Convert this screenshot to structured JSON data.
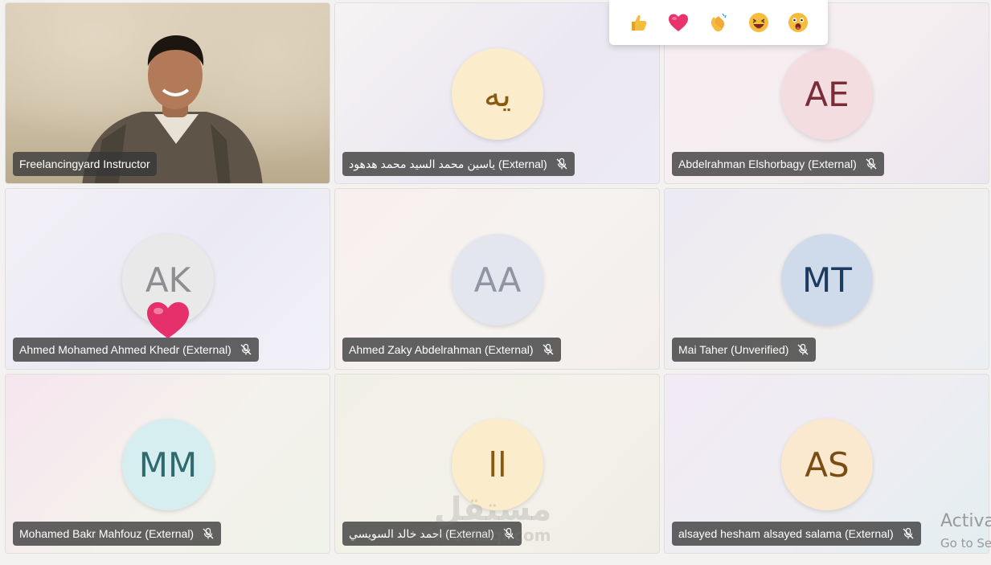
{
  "reactions": [
    {
      "name": "like",
      "icon": "thumbs-up-icon",
      "color": "#f2b233"
    },
    {
      "name": "heart",
      "icon": "heart-icon",
      "color": "#e8336d"
    },
    {
      "name": "clap",
      "icon": "clapping-hands-icon",
      "color": "#f2b233"
    },
    {
      "name": "laugh",
      "icon": "laughing-face-icon",
      "color": "#f2b233"
    },
    {
      "name": "surprised",
      "icon": "surprised-face-icon",
      "color": "#f2b233"
    }
  ],
  "participants": [
    {
      "name": "Freelancingyard Instructor",
      "video_on": true,
      "muted_icon": false
    },
    {
      "name": "ياسين محمد السيد محمد هدهود (External)",
      "initials": "يه",
      "avatar_bg": "#fbeccb",
      "avatar_fg": "#8a5a10",
      "muted_icon": true
    },
    {
      "name": "Abdelrahman Elshorbagy (External)",
      "initials": "AE",
      "avatar_bg": "#f4dde1",
      "avatar_fg": "#7a2c38",
      "muted_icon": true
    },
    {
      "name": "Ahmed Mohamed Ahmed Khedr (External)",
      "initials": "AK",
      "avatar_bg": "#e9e9ea",
      "avatar_fg": "#8e8e92",
      "muted_icon": true
    },
    {
      "name": "Ahmed Zaky Abdelrahman (External)",
      "initials": "AA",
      "avatar_bg": "#e3e6ee",
      "avatar_fg": "#8f95a3",
      "muted_icon": true
    },
    {
      "name": "Mai Taher (Unverified)",
      "initials": "MT",
      "avatar_bg": "#cfdaea",
      "avatar_fg": "#1d3a5f",
      "muted_icon": true
    },
    {
      "name": "Mohamed Bakr Mahfouz (External)",
      "initials": "MM",
      "avatar_bg": "#d6eef0",
      "avatar_fg": "#2f6b6e",
      "muted_icon": true
    },
    {
      "name": "احمد خالد السويسي (External)",
      "initials": "اا",
      "avatar_bg": "#fbeccb",
      "avatar_fg": "#8a5a10",
      "muted_icon": true
    },
    {
      "name": "alsayed hesham alsayed salama (External)",
      "initials": "AS",
      "avatar_bg": "#fbe9cf",
      "avatar_fg": "#7a4d12",
      "muted_icon": true
    }
  ],
  "overlay": {
    "floating_reaction": "heart-icon",
    "watermark_line1": "مستقل",
    "watermark_line2": "mostaql.com",
    "activation_line1": "Activa",
    "activation_line2": "Go to Se"
  }
}
